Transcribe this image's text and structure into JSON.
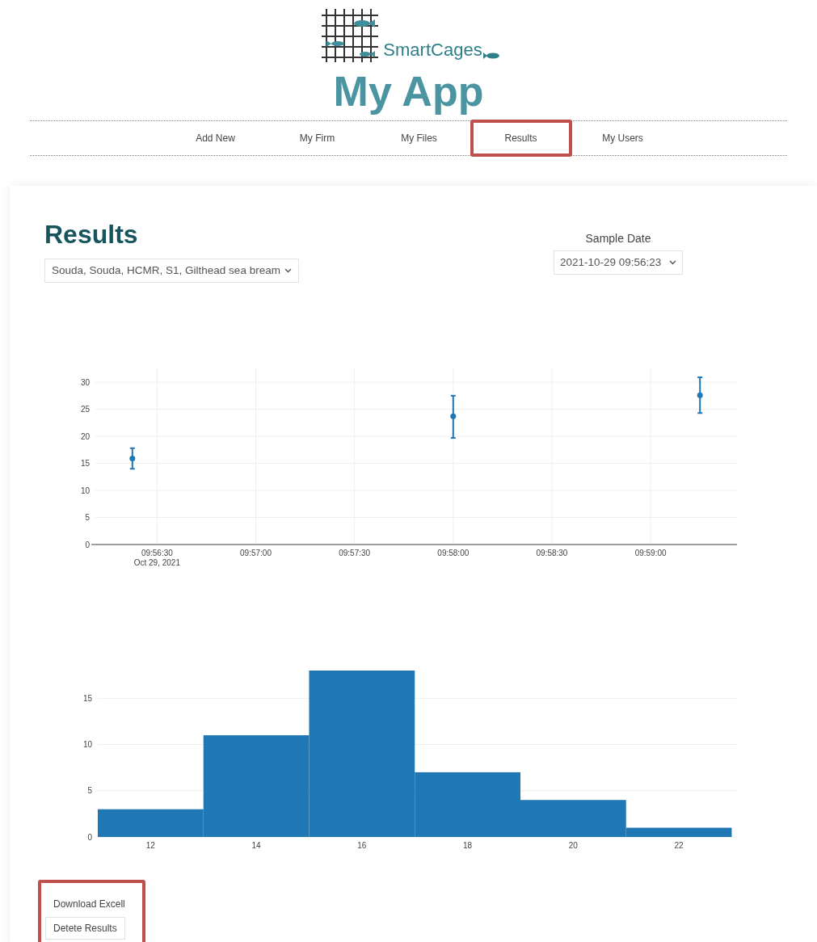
{
  "logo": {
    "text": "SmartCages"
  },
  "app_title": "My App",
  "nav": [
    {
      "label": "Add New",
      "highlighted": false
    },
    {
      "label": "My Firm",
      "highlighted": false
    },
    {
      "label": "My Files",
      "highlighted": false
    },
    {
      "label": "Results",
      "highlighted": true
    },
    {
      "label": "My Users",
      "highlighted": false
    }
  ],
  "page": {
    "heading": "Results",
    "location_select": {
      "value": "Souda, Souda, HCMR, S1, Gilthead sea bream"
    },
    "sample_date": {
      "label": "Sample Date",
      "value": "2021-10-29 09:56:23"
    }
  },
  "charts": [
    {
      "chart_data": {
        "type": "scatter",
        "categories": [
          null,
          null,
          "09:56:30",
          null,
          null,
          null,
          "09:57:00",
          null,
          null,
          null,
          "09:57:30",
          null,
          null,
          null,
          "09:58:00",
          null,
          null,
          null,
          "09:58:30",
          null,
          null,
          null,
          "09:59:00",
          null,
          null,
          null
        ],
        "series": [
          {
            "color": "#1f77b4",
            "values": [
              null,
              15.9,
              null,
              null,
              null,
              null,
              null,
              null,
              null,
              null,
              null,
              null,
              null,
              null,
              23.7,
              null,
              null,
              null,
              null,
              null,
              null,
              null,
              null,
              null,
              27.6,
              null
            ],
            "errors": [
              null,
              [
                14,
                17.8
              ],
              null,
              null,
              null,
              null,
              null,
              null,
              null,
              null,
              null,
              null,
              null,
              null,
              [
                19.7,
                27.5
              ],
              null,
              null,
              null,
              null,
              null,
              null,
              null,
              null,
              null,
              [
                24.3,
                30.9
              ],
              null
            ]
          }
        ],
        "ylim": [
          0,
          32.7
        ],
        "grid": true,
        "yticks": [
          0,
          5,
          10,
          15,
          20,
          25,
          30
        ],
        "annotations": [
          "Oct 29, 2021"
        ]
      }
    },
    {
      "chart_data": {
        "type": "bar",
        "x": [
          12,
          14,
          16,
          18,
          20,
          22
        ],
        "series": [
          {
            "color": "#1f77b4",
            "values": [
              3,
              11,
              18,
              7,
              4,
              1
            ]
          }
        ],
        "xlim": [
          11,
          23.1
        ],
        "ylim": [
          0,
          18
        ],
        "grid": true,
        "xticks": [
          12,
          14,
          16,
          18,
          20,
          22
        ],
        "yticks": [
          0,
          5,
          10,
          15
        ]
      }
    }
  ],
  "actions": {
    "highlighted": true,
    "buttons": [
      {
        "label": "Download Excell",
        "kind": "plain"
      },
      {
        "label": "Detete Results",
        "kind": "outlined"
      }
    ]
  }
}
